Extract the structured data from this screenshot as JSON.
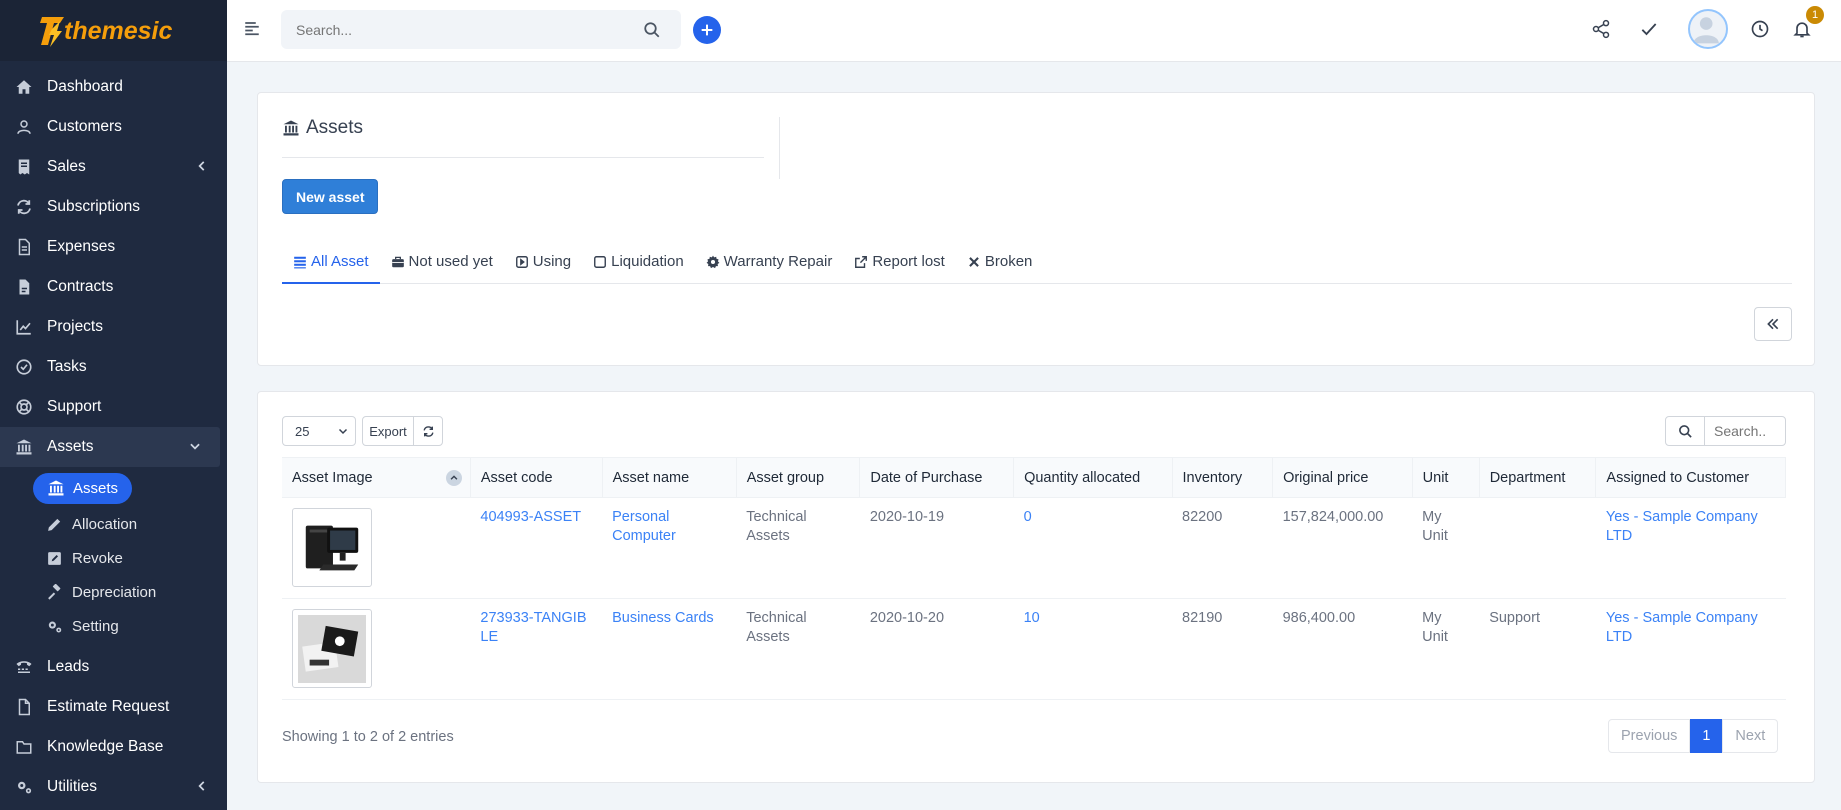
{
  "brand": {
    "name": "themesic"
  },
  "sidebar": {
    "items": [
      {
        "label": "Dashboard",
        "icon": "home-icon"
      },
      {
        "label": "Customers",
        "icon": "user-icon"
      },
      {
        "label": "Sales",
        "icon": "receipt-icon"
      },
      {
        "label": "Subscriptions",
        "icon": "refresh-icon"
      },
      {
        "label": "Expenses",
        "icon": "file-text-icon"
      },
      {
        "label": "Contracts",
        "icon": "file-icon"
      },
      {
        "label": "Projects",
        "icon": "chart-icon"
      },
      {
        "label": "Tasks",
        "icon": "check-circle-icon"
      },
      {
        "label": "Support",
        "icon": "lifebuoy-icon"
      },
      {
        "label": "Assets",
        "icon": "bank-icon"
      }
    ],
    "assets_sub": [
      {
        "label": "Assets",
        "icon": "bank-icon"
      },
      {
        "label": "Allocation",
        "icon": "pencil-icon"
      },
      {
        "label": "Revoke",
        "icon": "edit-square-icon"
      },
      {
        "label": "Depreciation",
        "icon": "gavel-icon"
      },
      {
        "label": "Setting",
        "icon": "cogs-icon"
      }
    ],
    "items_after": [
      {
        "label": "Leads",
        "icon": "tty-icon"
      },
      {
        "label": "Estimate Request",
        "icon": "file-icon"
      },
      {
        "label": "Knowledge Base",
        "icon": "folder-icon"
      },
      {
        "label": "Utilities",
        "icon": "cogs-icon"
      }
    ]
  },
  "topbar": {
    "search_placeholder": "Search...",
    "notification_count": "1"
  },
  "page": {
    "title": "Assets",
    "new_button": "New asset",
    "tabs": [
      {
        "label": "All Asset",
        "icon": "list-icon"
      },
      {
        "label": "Not used yet",
        "icon": "briefcase-icon"
      },
      {
        "label": "Using",
        "icon": "play-square-icon"
      },
      {
        "label": "Liquidation",
        "icon": "square-icon"
      },
      {
        "label": "Warranty Repair",
        "icon": "gear-icon"
      },
      {
        "label": "Report lost",
        "icon": "external-link-icon"
      },
      {
        "label": "Broken",
        "icon": "close-icon"
      }
    ]
  },
  "table": {
    "page_length": "25",
    "export_label": "Export",
    "search_placeholder": "Search..",
    "columns": [
      "Asset Image",
      "Asset code",
      "Asset name",
      "Asset group",
      "Date of Purchase",
      "Quantity allocated",
      "Inventory",
      "Original price",
      "Unit",
      "Department",
      "Assigned to Customer"
    ],
    "rows": [
      {
        "image": "computer-image",
        "code": "404993-ASSET",
        "name": "Personal Computer",
        "group": "Technical Assets",
        "date": "2020-10-19",
        "qty": "0",
        "inventory": "82200",
        "price": "157,824,000.00",
        "unit": "My Unit",
        "department": "",
        "assigned_prefix": "Yes - ",
        "assigned_customer": "Sample Company LTD"
      },
      {
        "image": "business-cards-image",
        "code": "273933-TANGIBLE",
        "name": "Business Cards",
        "group": "Technical Assets",
        "date": "2020-10-20",
        "qty": "10",
        "inventory": "82190",
        "price": "986,400.00",
        "unit": "My Unit",
        "department": "Support",
        "assigned_prefix": "Yes - ",
        "assigned_customer": "Sample Company LTD"
      }
    ],
    "info": "Showing 1 to 2 of 2 entries",
    "pager": {
      "prev": "Previous",
      "current": "1",
      "next": "Next"
    }
  },
  "colors": {
    "accent": "#2563eb",
    "sidebar_bg": "#1f2a40",
    "brand_orange": "#f59e0b"
  }
}
